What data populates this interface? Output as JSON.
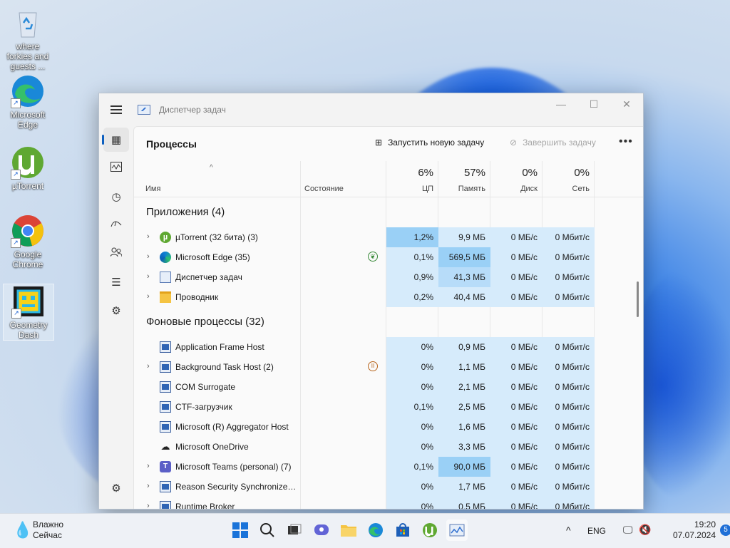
{
  "desktop": {
    "icons": [
      {
        "label": "where forkies and guests ...",
        "icon": "recycle-bin-icon"
      },
      {
        "label": "Microsoft Edge",
        "icon": "edge-icon"
      },
      {
        "label": "µTorrent",
        "icon": "utorrent-icon"
      },
      {
        "label": "Google Chrome",
        "icon": "chrome-icon"
      },
      {
        "label": "Geometry Dash",
        "icon": "geometry-dash-icon"
      }
    ]
  },
  "window": {
    "title": "Диспетчер задач",
    "page_title": "Процессы",
    "run_task": "Запустить новую задачу",
    "end_task": "Завершить задачу",
    "more": "•••",
    "columns": {
      "name": "Имя",
      "status": "Состояние",
      "cpu_pct": "6%",
      "cpu": "ЦП",
      "mem_pct": "57%",
      "mem": "Память",
      "disk_pct": "0%",
      "disk": "Диск",
      "net_pct": "0%",
      "net": "Сеть"
    },
    "apps_group": "Приложения (4)",
    "apps": [
      {
        "name": "µTorrent (32 бита) (3)",
        "cpu": "1,2%",
        "mem": "9,9 МБ",
        "disk": "0 МБ/с",
        "net": "0 Мбит/с"
      },
      {
        "name": "Microsoft Edge (35)",
        "cpu": "0,1%",
        "mem": "569,5 МБ",
        "disk": "0 МБ/с",
        "net": "0 Мбит/с"
      },
      {
        "name": "Диспетчер задач",
        "cpu": "0,9%",
        "mem": "41,3 МБ",
        "disk": "0 МБ/с",
        "net": "0 Мбит/с"
      },
      {
        "name": "Проводник",
        "cpu": "0,2%",
        "mem": "40,4 МБ",
        "disk": "0 МБ/с",
        "net": "0 Мбит/с"
      }
    ],
    "bg_group": "Фоновые процессы (32)",
    "bg": [
      {
        "name": "Application Frame Host",
        "cpu": "0%",
        "mem": "0,9 МБ",
        "disk": "0 МБ/с",
        "net": "0 Мбит/с"
      },
      {
        "name": "Background Task Host (2)",
        "cpu": "0%",
        "mem": "1,1 МБ",
        "disk": "0 МБ/с",
        "net": "0 Мбит/с"
      },
      {
        "name": "COM Surrogate",
        "cpu": "0%",
        "mem": "2,1 МБ",
        "disk": "0 МБ/с",
        "net": "0 Мбит/с"
      },
      {
        "name": "CTF-загрузчик",
        "cpu": "0,1%",
        "mem": "2,5 МБ",
        "disk": "0 МБ/с",
        "net": "0 Мбит/с"
      },
      {
        "name": "Microsoft (R) Aggregator Host",
        "cpu": "0%",
        "mem": "1,6 МБ",
        "disk": "0 МБ/с",
        "net": "0 Мбит/с"
      },
      {
        "name": "Microsoft OneDrive",
        "cpu": "0%",
        "mem": "3,3 МБ",
        "disk": "0 МБ/с",
        "net": "0 Мбит/с"
      },
      {
        "name": "Microsoft Teams (personal) (7)",
        "cpu": "0,1%",
        "mem": "90,0 МБ",
        "disk": "0 МБ/с",
        "net": "0 Мбит/с"
      },
      {
        "name": "Reason Security Synchronize S...",
        "cpu": "0%",
        "mem": "1,7 МБ",
        "disk": "0 МБ/с",
        "net": "0 Мбит/с"
      },
      {
        "name": "Runtime Broker",
        "cpu": "0%",
        "mem": "0,5 МБ",
        "disk": "0 МБ/с",
        "net": "0 Мбит/с"
      }
    ]
  },
  "taskbar": {
    "weather_line1": "Влажно",
    "weather_line2": "Сейчас",
    "lang": "ENG",
    "time": "19:20",
    "date": "07.07.2024",
    "notifications": "5"
  },
  "colors": {
    "accent": "#0d5fbf",
    "heat_low": "#d6ebfb",
    "heat_mid": "#b7dcf9",
    "heat_high": "#9ad0f6"
  }
}
